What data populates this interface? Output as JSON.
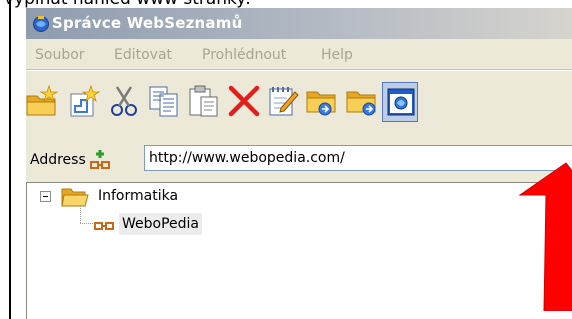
{
  "caption": "vypínat náhled www stránky:",
  "window": {
    "title": "Správce WebSeznamů",
    "menu": [
      "Soubor",
      "Editovat",
      "Prohlédnout",
      "Help"
    ]
  },
  "toolbar": {
    "buttons": [
      {
        "icon": "new-folder-star-icon"
      },
      {
        "icon": "new-link-star-icon"
      },
      {
        "icon": "scissors-icon"
      },
      {
        "icon": "copy-icon"
      },
      {
        "icon": "paste-icon"
      },
      {
        "icon": "delete-x-icon"
      },
      {
        "icon": "edit-notepad-icon"
      },
      {
        "icon": "folder-go-icon"
      },
      {
        "icon": "folder-forward-icon"
      },
      {
        "icon": "web-preview-icon",
        "active": true
      }
    ]
  },
  "address": {
    "label": "Address",
    "value": "http://www.webopedia.com/"
  },
  "tree": {
    "folder": {
      "label": "Informatika",
      "expanded": true
    },
    "items": [
      {
        "label": "WeboPedia",
        "selected": true
      }
    ]
  },
  "colors": {
    "annotation_arrow": "#ff0000",
    "active_button": "#bccde6",
    "folder": "#f5c542"
  }
}
